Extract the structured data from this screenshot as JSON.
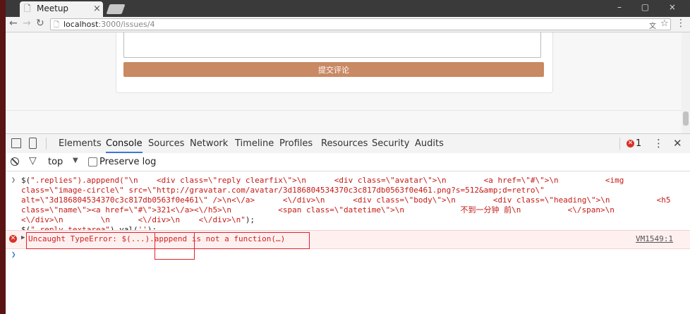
{
  "browser": {
    "tab_title": "Meetup",
    "tab_close": "×",
    "window_controls": "– ▢ ×",
    "url_host": "localhost",
    "url_path": ":3000/issues/4"
  },
  "page": {
    "submit_label": "提交评论"
  },
  "devtools": {
    "tabs": [
      "Elements",
      "Console",
      "Sources",
      "Network",
      "Timeline",
      "Profiles",
      "Resources",
      "Security",
      "Audits"
    ],
    "active_tab": "Console",
    "error_count": "1",
    "context": "top",
    "preserve_log": "Preserve log",
    "command_lines": [
      "$(\".replies\").apppend(\"\\n    <div class=\\\"reply clearfix\\\">\\n      <div class=\\\"avatar\\\">\\n        <a href=\\\"#\\\">\\n          <img",
      "class=\\\"image-circle\\\" src=\\\"http://gravatar.com/avatar/3d186804534370c3c817db0563f0e461.png?s=512&amp;d=retro\\\"",
      "alt=\\\"3d186804534370c3c817db0563f0e461\\\" />\\n<\\/a>      <\\/div>\\n      <div class=\\\"body\\\">\\n        <div class=\\\"heading\\\">\\n          <h5",
      "class=\\\"name\\\"><a href=\\\"#\\\">321<\\/a><\\/h5>\\n          <span class=\\\"datetime\\\">\\n            不到一分钟 前\\n          <\\/span>\\n",
      "<\\/div>\\n        \\n      <\\/div>\\n    <\\/div>\\n\");",
      "$(\".reply textarea\").val('');"
    ],
    "error_message": "Uncaught TypeError: $(...).apppend is not a function(…)",
    "error_source": "VM1549:1"
  }
}
